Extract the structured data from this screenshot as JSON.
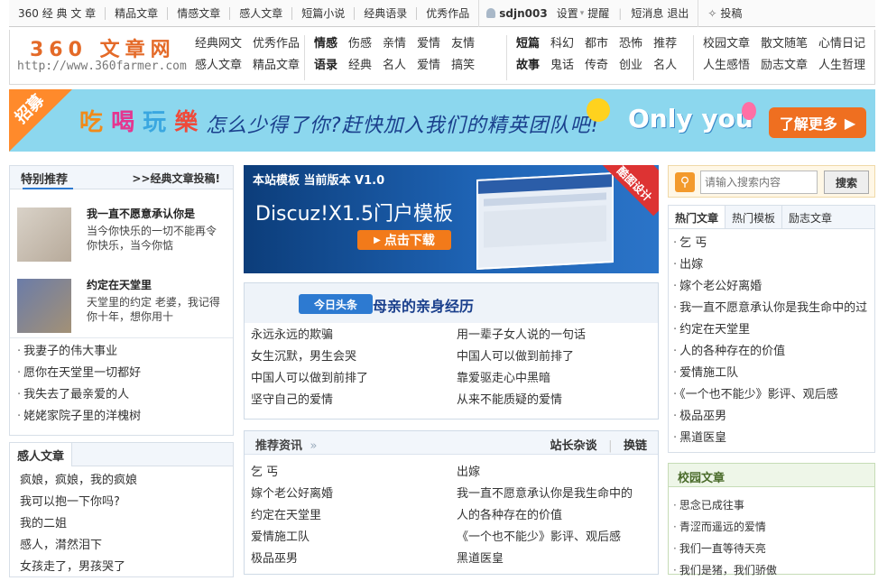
{
  "topbar": {
    "left_items": [
      "360 经 典 文 章",
      "精品文章",
      "情感文章",
      "感人文章",
      "短篇小说",
      "经典语录",
      "优秀作品"
    ],
    "username": "sdjn003",
    "settings": "设置",
    "remind": "提醒",
    "messages": "短消息",
    "logout": "退出",
    "contribute": "投稿"
  },
  "logo": {
    "title": "360 文章网",
    "url": "http://www.360farmer.com"
  },
  "nav": {
    "group1": {
      "row1": [
        "经典网文",
        "优秀作品"
      ],
      "row2": [
        "感人文章",
        "精品文章"
      ]
    },
    "group2": {
      "row1_head": "情感",
      "row1": [
        "伤感",
        "亲情",
        "爱情",
        "友情"
      ],
      "row2_head": "语录",
      "row2": [
        "经典",
        "名人",
        "爱情",
        "搞笑"
      ]
    },
    "group3": {
      "row1_head": "短篇",
      "row1": [
        "科幻",
        "都市",
        "恐怖",
        "推荐"
      ],
      "row2_head": "故事",
      "row2": [
        "鬼话",
        "传奇",
        "创业",
        "名人"
      ]
    },
    "group4": {
      "row1": [
        "校园文章",
        "散文随笔",
        "心情日记"
      ],
      "row2": [
        "人生感悟",
        "励志文章",
        "人生哲理"
      ]
    }
  },
  "banner": {
    "tag": "招募",
    "eat": [
      "吃",
      "喝",
      "玩",
      "樂"
    ],
    "slogan": "怎么少得了你?赶快加入我们的精英团队吧!",
    "only_you": "Only you",
    "learn_more": "了解更多"
  },
  "recommend": {
    "title": "特别推荐",
    "contribute": ">>经典文章投稿!",
    "features": [
      {
        "title": "我一直不愿意承认你是",
        "desc": "当今你快乐的一切不能再令你快乐，当今你惦"
      },
      {
        "title": "约定在天堂里",
        "desc": "天堂里的约定 老婆，我记得你十年，想你用十"
      }
    ],
    "list": [
      "我妻子的伟大事业",
      "愿你在天堂里一切都好",
      "我失去了最亲爱的人",
      "姥姥家院子里的洋槐树"
    ]
  },
  "touching": {
    "title": "感人文章",
    "list": [
      "疯娘，疯娘，我的疯娘",
      "我可以抱一下你吗?",
      "我的二姐",
      "感人，潸然泪下",
      "女孩走了，男孩哭了"
    ]
  },
  "dz_banner": {
    "line1": "本站模板 当前版本 V1.0",
    "line2": "Discuz!X1.5门户模板",
    "download": "点击下载",
    "corner": "酷图设计"
  },
  "headline": {
    "tag": "今日头条",
    "title": "母亲的亲身经历",
    "links": [
      "永远永远的欺骗",
      "用一辈子女人说的一句话",
      "女生沉默，男生会哭",
      "中国人可以做到前排了",
      "中国人可以做到前排了",
      "靠爱驱走心中黑暗",
      "坚守自己的爱情",
      "从来不能质疑的爱情"
    ]
  },
  "rec_news": {
    "title": "推荐资讯",
    "link1": "站长杂谈",
    "link2": "换链",
    "items": [
      "乞 丐",
      "出嫁",
      "嫁个老公好离婚",
      "我一直不愿意承认你是我生命中的",
      "约定在天堂里",
      "人的各种存在的价值",
      "爱情施工队",
      "《一个也不能少》影评、观后感",
      "极品巫男",
      "黑道医皇"
    ]
  },
  "search": {
    "placeholder": "请输入搜索内容",
    "button": "搜索"
  },
  "hot": {
    "tabs": [
      "热门文章",
      "热门模板",
      "励志文章"
    ],
    "list": [
      "乞 丐",
      "出嫁",
      "嫁个老公好离婚",
      "我一直不愿意承认你是我生命中的过",
      "约定在天堂里",
      "人的各种存在的价值",
      "爱情施工队",
      "《一个也不能少》影评、观后感",
      "极品巫男",
      "黑道医皇"
    ]
  },
  "school": {
    "title": "校园文章",
    "list": [
      "思念已成往事",
      "青涩而遥远的爱情",
      "我们一直等待天亮",
      "我们是猪，我们骄傲"
    ]
  },
  "colors": {
    "accent_blue": "#2d7ad1",
    "logo_orange": "#e46a28",
    "banner_bg": "#8cd7ee",
    "orange_button": "#ef6f20"
  }
}
